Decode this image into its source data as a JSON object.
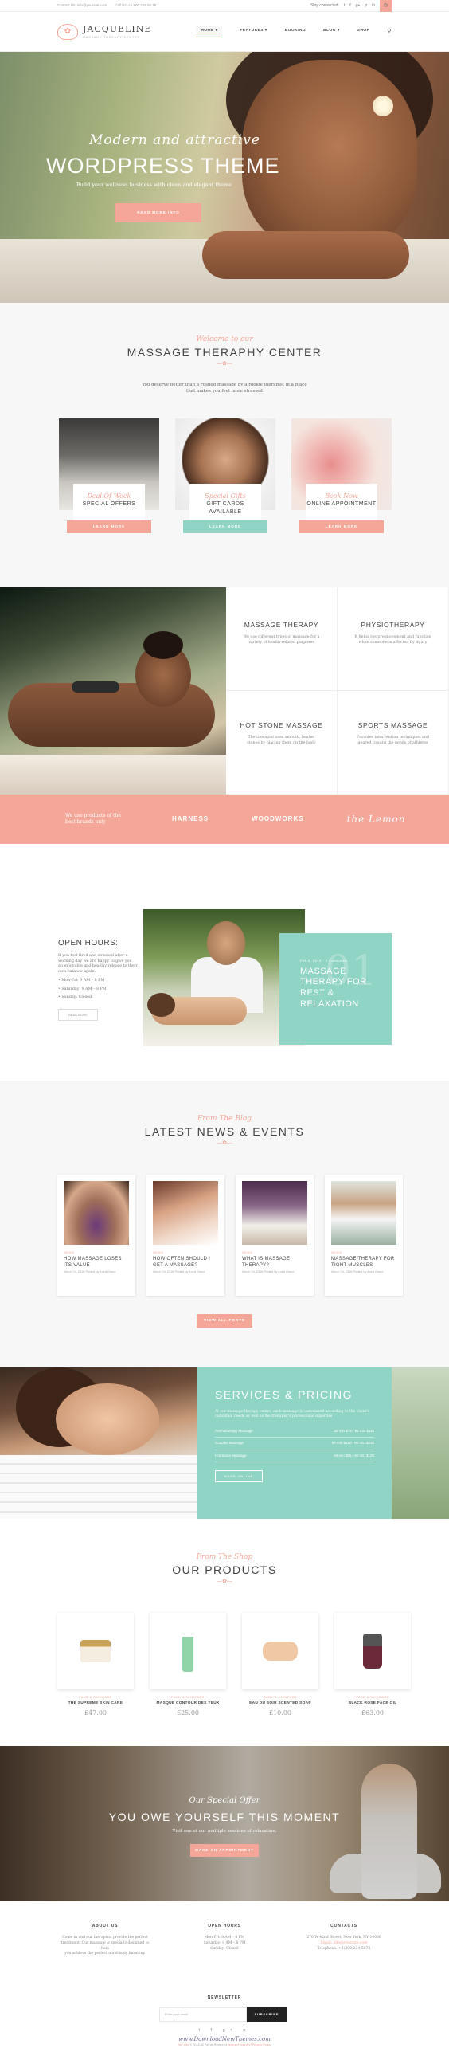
{
  "topbar": {
    "contact": "Contact Us: info@yoursite.com",
    "phone": "Call Us: +1 800 234 56 78",
    "right_text": "Stay connected:",
    "social": [
      "t",
      "f",
      "g+",
      "p",
      "in"
    ],
    "cart_icon": "bag-icon"
  },
  "header": {
    "logo_name": "JACQUELINE",
    "logo_tag": "MASSAGE THERAPY CENTER",
    "nav": [
      "HOME",
      "FEATURES",
      "BOOKING",
      "BLOG",
      "SHOP"
    ],
    "search_icon": "search-icon"
  },
  "hero": {
    "script": "Modern and attractive",
    "title": "WORDPRESS THEME",
    "subtitle": "Build your wellness business with clean and elegant theme",
    "button": "READ MORE INFO"
  },
  "welcome": {
    "script": "Welcome to our",
    "title": "MASSAGE THERAPHY CENTER",
    "intro": "You deserve better than a rushed massage by a rookie therapist in a place that makes you feel more stressed",
    "cards": [
      {
        "script": "Deal Of Week",
        "title": "SPECIAL OFFERS",
        "button": "LEARN MORE"
      },
      {
        "script": "Special Gifts",
        "title": "GIFT CARDS AVAILABLE",
        "button": "LEARN MORE"
      },
      {
        "script": "Book Now",
        "title": "ONLINE APPOINTMENT",
        "button": "LEARN MORE"
      }
    ]
  },
  "therapies": [
    {
      "title": "MASSAGE THERAPY",
      "desc": "We use different types of massage for a variety of health-related purposes"
    },
    {
      "title": "PHYSIOTHERAPY",
      "desc": "It helps restore movement and function when someone is affected by injury"
    },
    {
      "title": "HOT STONE MASSAGE",
      "desc": "The therapist uses smooth, heated stones by placing them on the body"
    },
    {
      "title": "SPORTS MASSAGE",
      "desc": "Provides intervention techniques and geared toward the needs of athletes"
    }
  ],
  "brands": {
    "lead": "We use products of the best brands only",
    "items": [
      "HARNESS",
      "WOODWORKS",
      "the Lemon"
    ]
  },
  "hours": {
    "title": "OPEN HOURS:",
    "desc": "If you feel tired and stressed after a working day we are happy to give you an enjoyable and healthy release to their own balance again.",
    "lines": [
      "Mon-Fri: 9 AM – 8 PM",
      "Saturday: 9 AM – 8 PM",
      "Sunday: Closed"
    ],
    "button": "READ MORE",
    "box_date": "Feb 8, 2016 · 0 Comments",
    "box_title": "MASSAGE THERAPY FOR REST & RELAXATION",
    "box_num": "01"
  },
  "news": {
    "script": "From The Blog",
    "title": "LATEST NEWS & EVENTS",
    "posts": [
      {
        "cat": "NEWS",
        "title": "HOW MASSAGE LOSES ITS VALUE",
        "meta": "March 24, 2016 Posted by Anna Grace"
      },
      {
        "cat": "NEWS",
        "title": "HOW OFTEN SHOULD I GET A MASSAGE?",
        "meta": "March 24, 2016 Posted by Anna Grace"
      },
      {
        "cat": "NEWS",
        "title": "WHAT IS MASSAGE THERAPY?",
        "meta": "March 24, 2016 Posted by Anna Grace"
      },
      {
        "cat": "NEWS",
        "title": "MASSAGE THERAPY FOR TIGHT MUSCLES",
        "meta": "March 24, 2016 Posted by Anna Grace"
      }
    ],
    "button": "VIEW ALL POSTS"
  },
  "services": {
    "title": "SERVICES & PRICING",
    "desc": "At our massage therapy center, each massage is customized according to the client's individual needs as well as the therapist's professional expertise",
    "rows": [
      {
        "name": "Aromatherapy Massage",
        "price": "60 min $75 / 90 min $110"
      },
      {
        "name": "Couples Massage",
        "price": "60 min $150 / 90 min $220"
      },
      {
        "name": "Hot Stone Massage",
        "price": "60 min $85 / 90 min $125"
      }
    ],
    "button": "BOOK ONLINE"
  },
  "products": {
    "script": "From The Shop",
    "title": "OUR PRODUCTS",
    "items": [
      {
        "cat": "FACE & SKINCARE",
        "title": "THE SUPREME SKIN CARE",
        "price": "£47.00"
      },
      {
        "cat": "FACE & SKINCARE",
        "title": "MASQUE CONTOUR DES YEUX",
        "price": "£25.00"
      },
      {
        "cat": "BODY & SKINCARE",
        "title": "EAU DU SOIR SCENTED SOAP",
        "price": "£10.00"
      },
      {
        "cat": "FACE & SKINCARE",
        "title": "BLACK ROSE FACE OIL",
        "price": "£63.00"
      }
    ]
  },
  "offer": {
    "script": "Our Special Offer",
    "title": "YOU OWE YOURSELF THIS MOMENT",
    "desc": "Visit one of our multiple sessions of relaxation.",
    "button": "MAKE AN APPOINTMENT"
  },
  "footer": {
    "cols": [
      {
        "title": "ABOUT US",
        "lines": [
          "Come in and our therapists provide the perfect",
          "treatment. Our massage is specially designed to help",
          "you achieve the perfect mind-body harmony."
        ]
      },
      {
        "title": "OPEN HOURS",
        "lines": [
          "Mon-Fri: 9 AM – 8 PM",
          "Saturday: 9 AM – 8 PM",
          "Sunday: Closed"
        ]
      },
      {
        "title": "CONTACTS",
        "lines": [
          "270 W 42nd Street, New York, NY 10036",
          "Email: info@yoursite.com",
          "Telephone: +1(800)234-5678"
        ]
      }
    ],
    "newsletter_title": "NEWSLETTER",
    "newsletter_placeholder": "Enter your email",
    "newsletter_button": "SUBSCRIBE",
    "social": "t f g+ p",
    "watermark": "www.DownloadNewThemes.com",
    "copyright_a": "AnCode",
    "copyright_b": " © 2016 All Rights Reserved ",
    "copyright_c": "Terms of Use and Privacy Policy"
  },
  "colors": {
    "accent": "#f4a798",
    "teal": "#8fd4c5"
  }
}
